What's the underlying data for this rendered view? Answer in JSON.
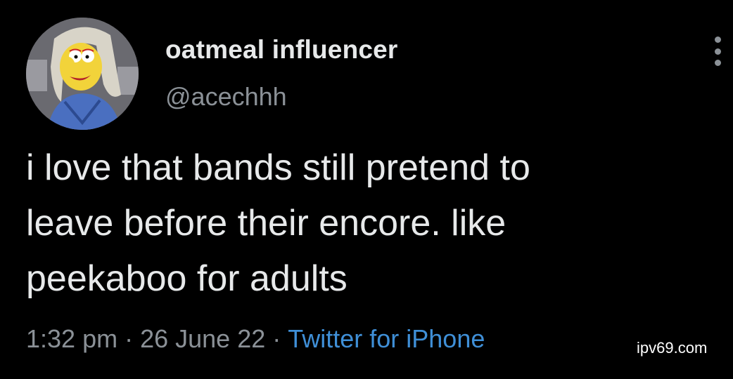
{
  "user": {
    "display_name": "oatmeal influencer",
    "handle": "@acechhh",
    "avatar_icon": "cartoon-avatar"
  },
  "menu": {
    "icon": "more-options-icon"
  },
  "tweet": {
    "lines": [
      "i love that bands still pretend to",
      "leave before their encore. like",
      "peekaboo for adults"
    ],
    "time": "1:32 pm",
    "date": "26 June 22",
    "separator": "·",
    "source": "Twitter for iPhone"
  },
  "watermark": "ipv69.com",
  "colors": {
    "background": "#000000",
    "text": "#e7e9ea",
    "muted": "#8b9197",
    "link": "#3f8fd7"
  }
}
